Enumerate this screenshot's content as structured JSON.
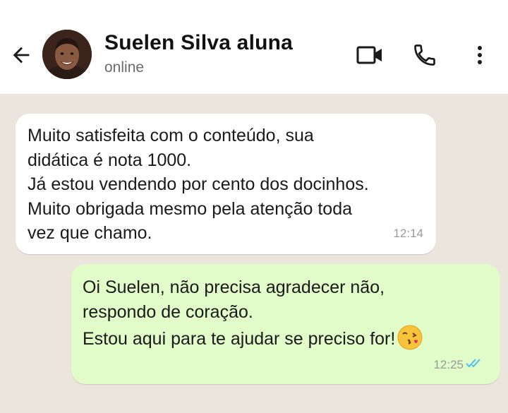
{
  "header": {
    "contact_name": "Suelen Silva aluna",
    "status": "online"
  },
  "messages": [
    {
      "direction": "incoming",
      "text": "Muito satisfeita com o conteúdo, sua\ndidática é nota 1000.\nJá estou vendendo por cento dos docinhos.\nMuito obrigada mesmo pela atenção toda\nvez que  chamo.",
      "time": "12:14"
    },
    {
      "direction": "outgoing",
      "text": "Oi Suelen, não precisa agradecer não,\nrespondo de coração.\nEstou aqui para te ajudar se preciso for!",
      "emoji": "face-blowing-a-kiss",
      "time": "12:25",
      "read_receipt": "double-check-blue"
    }
  ],
  "colors": {
    "chat_background": "#ece5dd",
    "incoming_bubble": "#ffffff",
    "outgoing_bubble": "#e1fcc9",
    "read_tick": "#53bdeb"
  }
}
